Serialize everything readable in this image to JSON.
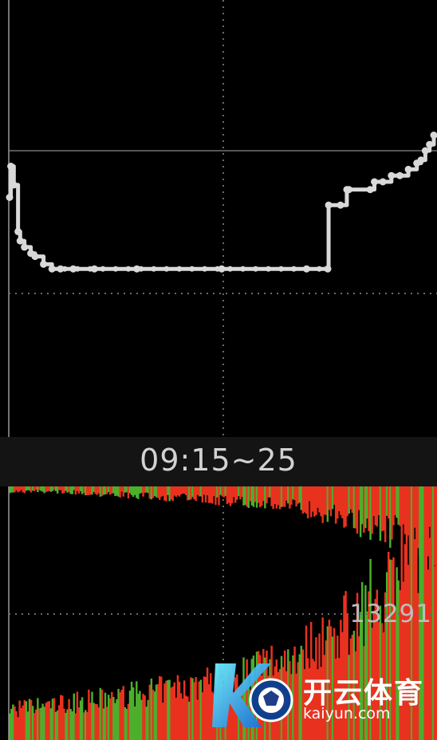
{
  "time_range_label": "09:15~25",
  "volume_label": "13291",
  "watermark": {
    "chinese": "开云体育",
    "url": "kaiyun.com"
  },
  "colors": {
    "background": "#000000",
    "price_line": "#d9d9d9",
    "grid": "#6a6a6a",
    "bar_up": "#e8321f",
    "bar_down": "#4caf2c",
    "separator": "#141414",
    "watermark_blue": "#1e88e5"
  },
  "chart_data": [
    {
      "type": "line",
      "series": [
        {
          "x": [
            0,
            0.3,
            1.0,
            2.0,
            2.5,
            3.5,
            5.0,
            6.0,
            8.0,
            10.0,
            12.0,
            15.0,
            20.0,
            30.0,
            50.0,
            70.0,
            75.0,
            75.2,
            78.0,
            79.5,
            80.0,
            85.0,
            86.0,
            88.0,
            90.0,
            92.0,
            94.0,
            96.0,
            97.0,
            98.0,
            99.0,
            100.0
          ],
          "y": [
            0.5,
            0.3,
            0.42,
            0.72,
            0.78,
            0.82,
            0.86,
            0.88,
            0.93,
            0.96,
            0.96,
            0.96,
            0.96,
            0.96,
            0.96,
            0.96,
            0.96,
            0.55,
            0.55,
            0.45,
            0.45,
            0.45,
            0.4,
            0.4,
            0.36,
            0.36,
            0.32,
            0.28,
            0.26,
            0.2,
            0.16,
            0.1
          ]
        }
      ],
      "reference_y": 0.2,
      "xlim": [
        0,
        100
      ],
      "ylim": [
        0,
        1
      ],
      "grid": "dotted"
    },
    {
      "type": "bar",
      "seed": 7,
      "n": 260,
      "top_profile": [
        0.02,
        0.02,
        0.03,
        0.04,
        0.05,
        0.06,
        0.08,
        0.12,
        0.18,
        0.25
      ],
      "bottom_profile": [
        0.12,
        0.14,
        0.16,
        0.19,
        0.22,
        0.27,
        0.34,
        0.44,
        0.62,
        0.95
      ],
      "grid": "dotted"
    }
  ]
}
